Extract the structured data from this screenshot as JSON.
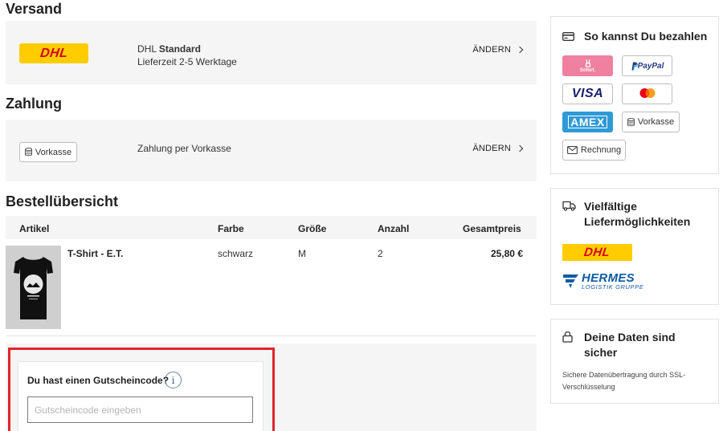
{
  "shipping": {
    "title": "Versand",
    "carrier": "DHL",
    "carrier_logo_text": "DHL",
    "method": "Standard",
    "delivery_time": "Lieferzeit 2-5 Werktage",
    "change_label": "ÄNDERN"
  },
  "payment": {
    "title": "Zahlung",
    "method_badge": "Vorkasse",
    "description": "Zahlung per Vorkasse",
    "change_label": "ÄNDERN"
  },
  "order": {
    "title": "Bestellübersicht",
    "columns": [
      "Artikel",
      "Farbe",
      "Größe",
      "Anzahl",
      "Gesamtpreis"
    ],
    "items": [
      {
        "name": "T-Shirt - E.T.",
        "color": "schwarz",
        "size": "M",
        "quantity": "2",
        "total": "25,80 €"
      }
    ]
  },
  "voucher": {
    "label": "Du hast einen Gutscheincode?",
    "info_glyph": "i",
    "placeholder": "Gutscheincode eingeben"
  },
  "sidebar": {
    "payment_card": {
      "title": "So kannst Du bezahlen",
      "methods": {
        "sofort": "Sofort.",
        "paypal": "PayPal",
        "visa": "VISA",
        "amex": "AMEX",
        "vorkasse": "Vorkasse",
        "rechnung": "Rechnung"
      }
    },
    "delivery_card": {
      "title_line1": "Vielfältige",
      "title_line2": "Liefermöglichkeiten",
      "dhl_logo_text": "DHL",
      "hermes_text": "HERMES",
      "hermes_sub": "LOGISTIK GRUPPE"
    },
    "security_card": {
      "title_line1": "Deine Daten sind",
      "title_line2": "sicher",
      "text_line1": "Sichere Datenübertragung durch SSL-",
      "text_line2": "Verschlüsselung"
    }
  },
  "colors": {
    "dhl_yellow": "#ffcc00",
    "dhl_red": "#d40511",
    "highlight_red": "#e2242c",
    "sofort_pink": "#ef809f",
    "amex_blue": "#2e9ad6",
    "visa_navy": "#1a1f71",
    "paypal_blue": "#253b80",
    "hermes_blue": "#0f5aa6"
  }
}
